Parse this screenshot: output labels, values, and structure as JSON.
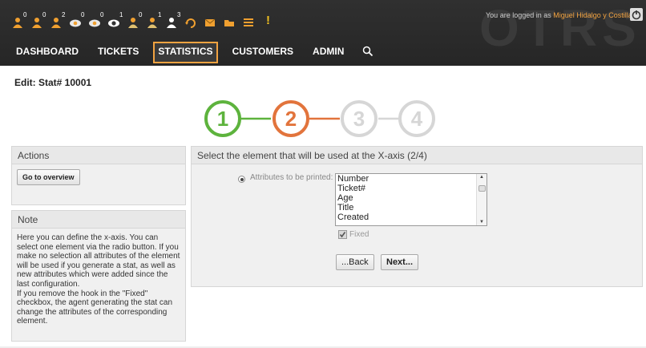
{
  "toolbar": {
    "items": [
      {
        "icon": "agent-icon",
        "badge": "0"
      },
      {
        "icon": "agent-icon",
        "badge": "0"
      },
      {
        "icon": "agent-icon",
        "badge": "2"
      },
      {
        "icon": "watched-icon",
        "badge": "0"
      },
      {
        "icon": "watched-icon",
        "badge": "0"
      },
      {
        "icon": "eye-icon",
        "badge": "1"
      },
      {
        "icon": "responsible-icon",
        "badge": "0"
      },
      {
        "icon": "responsible-icon",
        "badge": "1"
      },
      {
        "icon": "owner-icon",
        "badge": "3"
      },
      {
        "icon": "refresh-icon",
        "badge": ""
      },
      {
        "icon": "mail-icon",
        "badge": ""
      },
      {
        "icon": "folder-icon",
        "badge": ""
      },
      {
        "icon": "list-icon",
        "badge": ""
      }
    ],
    "alert": "!"
  },
  "login": {
    "prefix": "You are logged in as",
    "user": "Miguel Hidalgo y Costilla"
  },
  "nav": {
    "items": [
      "DASHBOARD",
      "TICKETS",
      "STATISTICS",
      "CUSTOMERS",
      "ADMIN"
    ],
    "selected": "STATISTICS"
  },
  "page": {
    "title": "Edit: Stat# 10001"
  },
  "steps": {
    "labels": [
      "1",
      "2",
      "3",
      "4"
    ],
    "colors": [
      "#5db33d",
      "#e2743c",
      "#d6d6d6",
      "#d6d6d6"
    ]
  },
  "actions": {
    "heading": "Actions",
    "goto_label": "Go to overview"
  },
  "note": {
    "heading": "Note",
    "text": "Here you can define the x-axis. You can select one element via the radio button. If you make no selection all attributes of the element will be used if you generate a stat, as well as new attributes which were added since the last configuration.\nIf you remove the hook in the \"Fixed\" checkbox, the agent generating the stat can change the attributes of the corresponding element."
  },
  "main": {
    "heading": "Select the element that will be used at the X-axis (2/4)",
    "attr_label": "Attributes to be printed:",
    "options": [
      "Number",
      "Ticket#",
      "Age",
      "Title",
      "Created"
    ],
    "fixed_label": "Fixed",
    "fixed_checked": true,
    "back_label": "...Back",
    "next_label": "Next..."
  },
  "brand": {
    "logo_text": "OTRS",
    "accent": "#f2a341"
  }
}
